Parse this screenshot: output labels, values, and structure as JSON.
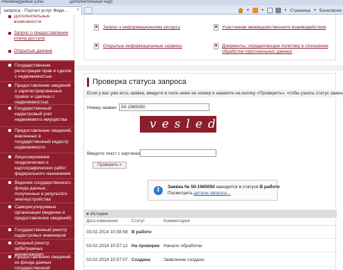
{
  "browser": {
    "favorites_bar": [
      "Рекомендуемые узлы",
      "Дополнительные надс"
    ],
    "tab_title": "запроса - Портал услуг Феде...",
    "toolbar": {
      "page_menu": "Страница",
      "safety_menu": "Безопасно"
    }
  },
  "sidebar": {
    "top_links": [
      {
        "label": "Дополнительные возможности",
        "link": false
      },
      {
        "label": "Запрос о предоставлении ключа доступа",
        "link": true
      },
      {
        "label": "Открытые данные",
        "link": true
      }
    ],
    "items": [
      "Государственная регистрация прав и сделок с недвижимостью",
      "Предоставление сведений о зарегистрированных правах и сделках с недвижимостью",
      "Государственный кадастровый учет недвижимого имущества",
      "Предоставление сведений, внесенных в государственный кадастр недвижимости",
      "Лицензирование геодезических и картографических работ федерального назначения",
      "Ведение государственного фонда данных, полученных в результате землеустройства",
      "Саморегулируемые организации (ведение и предоставление сведений)",
      "Государственный реестр кадастровых инженеров",
      "Сводный реестр арбитражных управляющих",
      "Предоставление сведений из фонда данных государственной"
    ]
  },
  "links_panel": {
    "left": [
      "Запрос к информационному ресурсу",
      "Открытые информационные сервисы"
    ],
    "right": [
      "Участникам межведомственного взаимодействия",
      "Документы, определяющие политику в отношении обработки персональных данных"
    ]
  },
  "status_check": {
    "title": "Проверка статуса запроса",
    "description": "Если у вас уже есть заявка, введите в поле ниже ее номер и нажмите на кнопку «Проверить», чтобы узнать статус заявки.",
    "request_number_label": "Номер заявки:",
    "request_number_value": "50-1965050",
    "captcha_text": "vesled",
    "captcha_label": "Введите текст с картинки:",
    "captcha_input_value": "",
    "check_button": "Проверить »",
    "notice_prefix": "Заявка № 50-1965050",
    "notice_middle": " находится в статусе ",
    "notice_status": "В работе",
    "notice_link_prefix": "Посмотреть ",
    "notice_link": "детали запроса..."
  },
  "history": {
    "title": "История",
    "columns": [
      "Дата изменения",
      "Статус",
      "Комментарий"
    ],
    "rows": [
      {
        "date": "03.02.2014 10:58:58",
        "status": "В работе",
        "comment": ""
      },
      {
        "date": "03.02.2014 10:57:12",
        "status": "На проверке",
        "comment": "Начало обработки"
      },
      {
        "date": "03.02.2014 10:57:07",
        "status": "Создана",
        "comment": "Заявление создано"
      }
    ]
  },
  "colors": {
    "brand": "#8f1d2c",
    "link_blue": "#2a58a8",
    "info_blue": "#2d79c7"
  }
}
